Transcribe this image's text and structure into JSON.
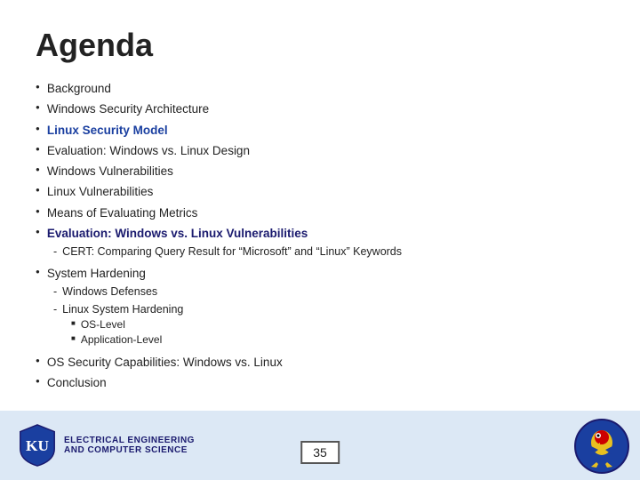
{
  "slide": {
    "title": "Agenda",
    "items": [
      {
        "id": "background",
        "text": "Background",
        "style": "normal",
        "subitems": []
      },
      {
        "id": "windows-security",
        "text": "Windows Security Architecture",
        "style": "normal",
        "subitems": []
      },
      {
        "id": "linux-security",
        "text": "Linux Security Model",
        "style": "blue-bold",
        "subitems": []
      },
      {
        "id": "evaluation-design",
        "text": "Evaluation: Windows vs. Linux Design",
        "style": "normal",
        "subitems": []
      },
      {
        "id": "windows-vuln",
        "text": "Windows Vulnerabilities",
        "style": "normal",
        "subitems": []
      },
      {
        "id": "linux-vuln",
        "text": "Linux Vulnerabilities",
        "style": "normal",
        "subitems": []
      },
      {
        "id": "means-eval",
        "text": "Means of Evaluating Metrics",
        "style": "normal",
        "subitems": []
      },
      {
        "id": "eval-vuln",
        "text": "Evaluation: Windows vs. Linux Vulnerabilities",
        "style": "navy-bold",
        "subitems": [
          {
            "text": "CERT: Comparing Query Result for “Microsoft” and “Linux” Keywords",
            "children": []
          }
        ]
      },
      {
        "id": "system-hardening",
        "text": "System Hardening",
        "style": "normal",
        "subitems": [
          {
            "text": "Windows Defenses",
            "children": []
          },
          {
            "text": "Linux System Hardening",
            "children": [
              {
                "text": "OS-Level"
              },
              {
                "text": "Application-Level"
              }
            ]
          }
        ]
      },
      {
        "id": "os-security",
        "text": "OS Security Capabilities: Windows vs. Linux",
        "style": "normal",
        "subitems": []
      },
      {
        "id": "conclusion",
        "text": "Conclusion",
        "style": "normal",
        "subitems": []
      }
    ],
    "footer": {
      "dept_line1": "ELECTRICAL ENGINEERING",
      "dept_line2": "AND COMPUTER SCIENCE",
      "page_number": "35"
    }
  }
}
